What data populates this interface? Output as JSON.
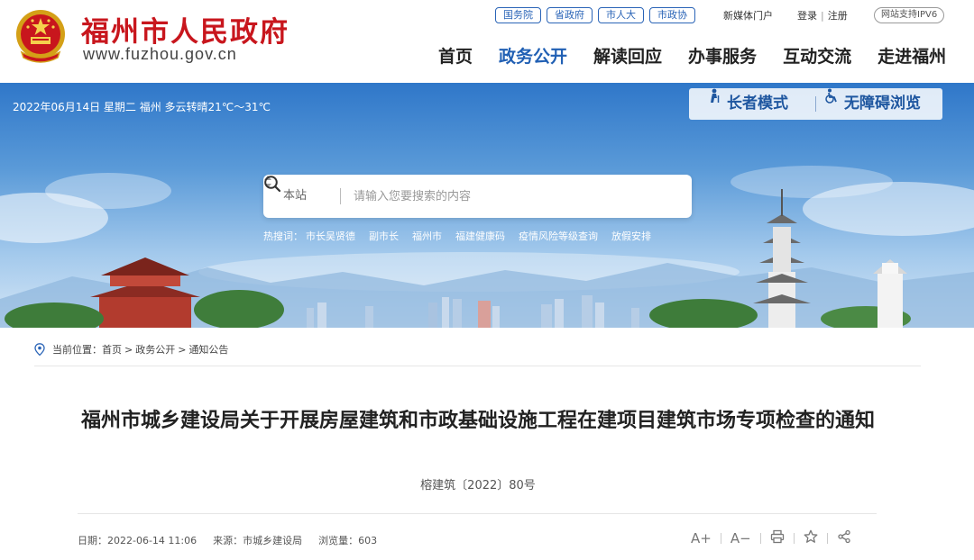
{
  "header": {
    "site_name": "福州市人民政府",
    "site_url": "www.fuzhou.gov.cn",
    "quick_links": [
      "国务院",
      "省政府",
      "市人大",
      "市政协"
    ],
    "media_link": "新媒体门户",
    "login": "登录",
    "register": "注册",
    "login_sep": "|",
    "ipv6_badge": "网站支持IPV6",
    "nav": [
      "首页",
      "政务公开",
      "解读回应",
      "办事服务",
      "互动交流",
      "走进福州"
    ],
    "active_nav": "政务公开"
  },
  "banner": {
    "weather": "2022年06月14日 星期二 福州 多云转晴21℃～31℃",
    "elder_mode": "长者模式",
    "accessible_mode": "无障碍浏览",
    "search": {
      "scope": "本站",
      "placeholder": "请输入您要搜索的内容"
    },
    "hot_label": "热搜词：",
    "hot_words": [
      "市长吴贤德",
      "副市长",
      "福州市",
      "福建健康码",
      "疫情风险等级查询",
      "放假安排"
    ]
  },
  "article": {
    "breadcrumb_label": "当前位置：",
    "breadcrumb": [
      "首页",
      "政务公开",
      "通知公告"
    ],
    "breadcrumb_sep": ">",
    "title": "福州市城乡建设局关于开展房屋建筑和市政基础设施工程在建项目建筑市场专项检查的通知",
    "doc_number": "榕建筑〔2022〕80号",
    "date": "日期：2022-06-14 11:06",
    "source": "来源：市城乡建设局",
    "views": "浏览量：603",
    "font_increase": "A+",
    "font_decrease": "A−"
  },
  "colors": {
    "brand_red": "#c8161d",
    "nav_blue": "#2160b4",
    "banner_blue": "#2f77c9"
  },
  "icons": [
    "national-emblem-icon",
    "sort-arrows-icon",
    "search-icon",
    "elder-icon",
    "wheelchair-icon",
    "location-icon",
    "print-icon",
    "star-icon",
    "share-icon"
  ]
}
